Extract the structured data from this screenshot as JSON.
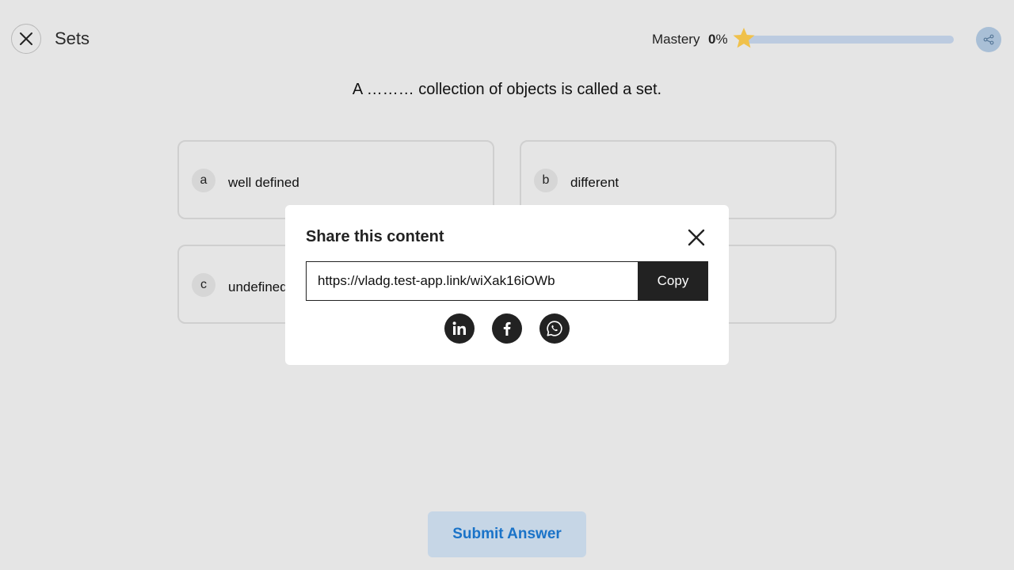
{
  "header": {
    "title": "Sets",
    "mastery_label": "Mastery",
    "mastery_value": "0",
    "mastery_unit": "%",
    "mastery_fraction": 0
  },
  "question": "A ……… collection of objects is called a set.",
  "options": [
    {
      "letter": "a",
      "text": "well defined"
    },
    {
      "letter": "b",
      "text": "different"
    },
    {
      "letter": "c",
      "text": "undefined"
    }
  ],
  "submit_label": "Submit Answer",
  "share_modal": {
    "title": "Share this content",
    "url": "https://vladg.test-app.link/wiXak16iOWb",
    "copy_label": "Copy",
    "socials": [
      "linkedin-icon",
      "facebook-icon",
      "whatsapp-icon"
    ]
  },
  "colors": {
    "background": "#e5e5e5",
    "accent": "#1a73c8",
    "star": "#f0c14b",
    "dark": "#222222"
  }
}
